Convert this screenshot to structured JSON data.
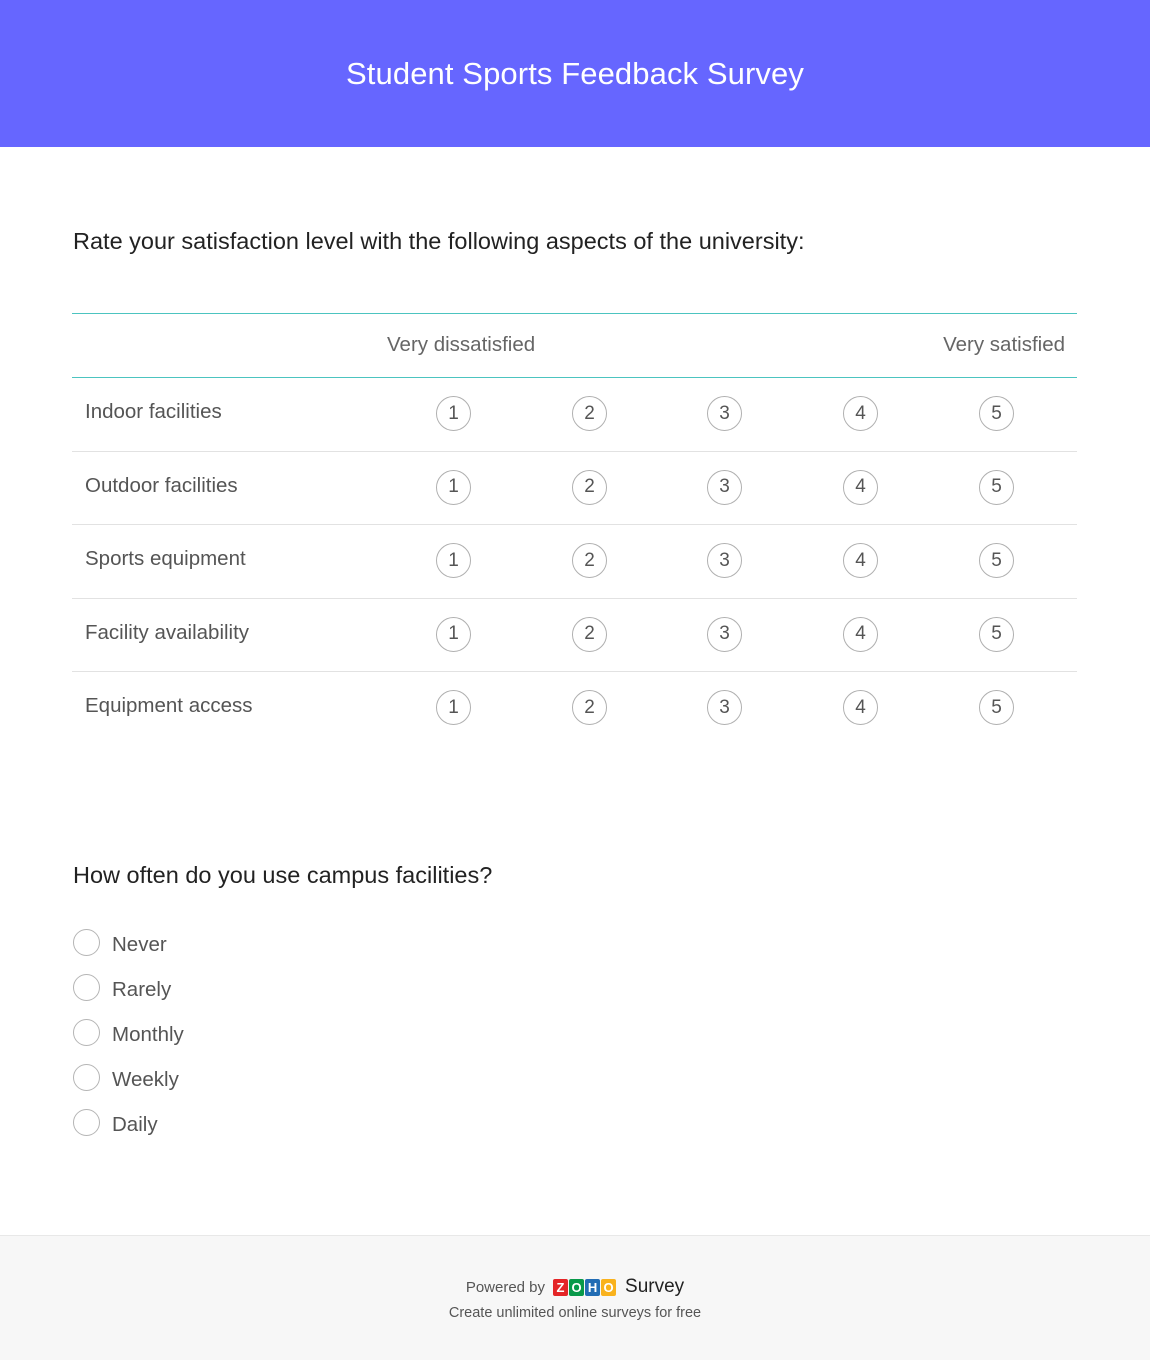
{
  "header": {
    "title": "Student Sports Feedback Survey",
    "color": "#6666ff"
  },
  "question1": {
    "title": "Rate your satisfaction level with the following aspects of the university:",
    "scale_low": "Very dissatisfied",
    "scale_high": "Very satisfied",
    "scale_values": [
      "1",
      "2",
      "3",
      "4",
      "5"
    ],
    "rows": [
      {
        "label": "Indoor facilities"
      },
      {
        "label": "Outdoor facilities"
      },
      {
        "label": "Sports equipment"
      },
      {
        "label": "Facility availability"
      },
      {
        "label": "Equipment access"
      }
    ]
  },
  "question2": {
    "title": "How often do you use campus facilities?",
    "options": [
      "Never",
      "Rarely",
      "Monthly",
      "Weekly",
      "Daily"
    ]
  },
  "footer": {
    "powered_by": "Powered by",
    "logo_letters": [
      {
        "char": "Z",
        "color": "#e42527"
      },
      {
        "char": "O",
        "color": "#089949"
      },
      {
        "char": "H",
        "color": "#226db4"
      },
      {
        "char": "O",
        "color": "#f9b21d"
      }
    ],
    "product": "Survey",
    "tagline": "Create unlimited online surveys for free"
  }
}
